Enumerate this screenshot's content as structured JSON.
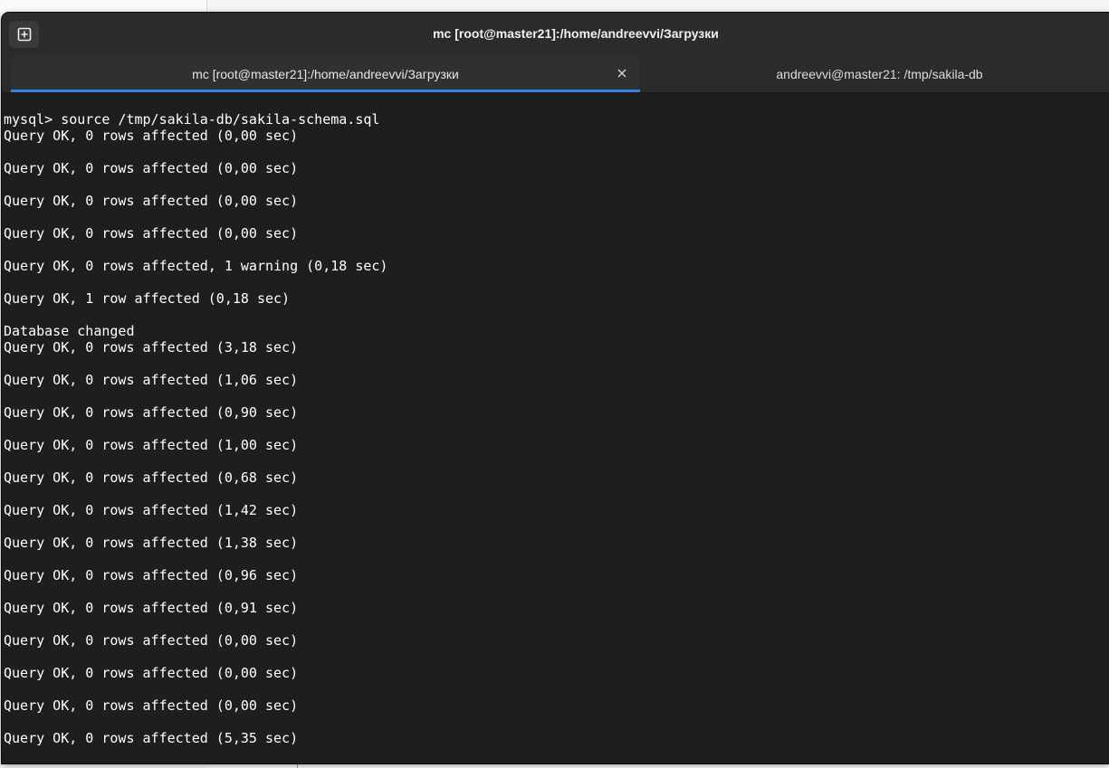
{
  "window": {
    "title": "mc [root@master21]:/home/andreevvi/Загрузки"
  },
  "tabs": [
    {
      "label": "mc [root@master21]:/home/andreevvi/Загрузки",
      "active": true
    },
    {
      "label": "andreevvi@master21: /tmp/sakila-db",
      "active": false
    }
  ],
  "icons": {
    "new_tab": "new-tab-icon",
    "close": "close-icon"
  },
  "colors": {
    "accent": "#3584e4",
    "terminal_bg": "#1e1e1e",
    "terminal_fg": "#ffffff"
  },
  "terminal": {
    "lines": [
      "mysql> source /tmp/sakila-db/sakila-schema.sql",
      "Query OK, 0 rows affected (0,00 sec)",
      "",
      "Query OK, 0 rows affected (0,00 sec)",
      "",
      "Query OK, 0 rows affected (0,00 sec)",
      "",
      "Query OK, 0 rows affected (0,00 sec)",
      "",
      "Query OK, 0 rows affected, 1 warning (0,18 sec)",
      "",
      "Query OK, 1 row affected (0,18 sec)",
      "",
      "Database changed",
      "Query OK, 0 rows affected (3,18 sec)",
      "",
      "Query OK, 0 rows affected (1,06 sec)",
      "",
      "Query OK, 0 rows affected (0,90 sec)",
      "",
      "Query OK, 0 rows affected (1,00 sec)",
      "",
      "Query OK, 0 rows affected (0,68 sec)",
      "",
      "Query OK, 0 rows affected (1,42 sec)",
      "",
      "Query OK, 0 rows affected (1,38 sec)",
      "",
      "Query OK, 0 rows affected (0,96 sec)",
      "",
      "Query OK, 0 rows affected (0,91 sec)",
      "",
      "Query OK, 0 rows affected (0,00 sec)",
      "",
      "Query OK, 0 rows affected (0,00 sec)",
      "",
      "Query OK, 0 rows affected (0,00 sec)",
      "",
      "Query OK, 0 rows affected (5,35 sec)"
    ]
  }
}
